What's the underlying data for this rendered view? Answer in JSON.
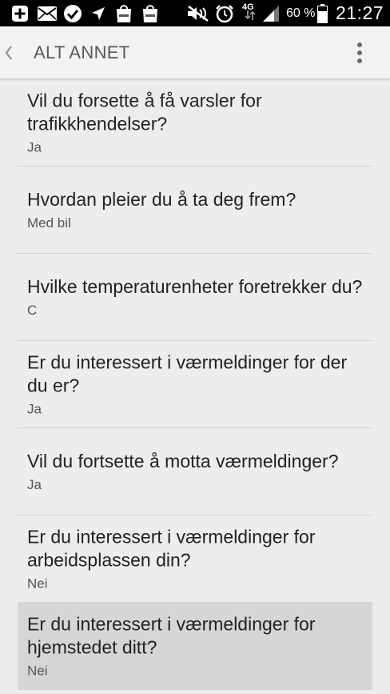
{
  "status_bar": {
    "network_type": "4G",
    "battery_percent": "60 %",
    "time": "21:27",
    "icons": [
      "plus-icon",
      "mail-icon",
      "check-icon",
      "location-arrow-icon",
      "galaxy-app-icon",
      "galaxy-app-icon",
      "mute-icon",
      "alarm-icon",
      "signal-icon",
      "battery-icon"
    ]
  },
  "action_bar": {
    "title": "ALT ANNET"
  },
  "settings": [
    {
      "title": "Vil du forsette å få varsler for trafikkhendelser?",
      "value": "Ja"
    },
    {
      "title": "Hvordan pleier du å ta deg frem?",
      "value": "Med bil"
    },
    {
      "title": "Hvilke temperaturenheter foretrekker du?",
      "value": "C"
    },
    {
      "title": "Er du interessert i værmeldinger for der du er?",
      "value": "Ja"
    },
    {
      "title": "Vil du fortsette å motta værmeldinger?",
      "value": "Ja"
    },
    {
      "title": "Er du interessert i værmeldinger for arbeidsplassen din?",
      "value": "Nei"
    },
    {
      "title": "Er du interessert i værmeldinger for hjemstedet ditt?",
      "value": "Nei"
    }
  ],
  "colors": {
    "background": "#ededed",
    "selected_row": "#d6d6d6",
    "title_text": "#222222",
    "value_text": "#555555"
  }
}
